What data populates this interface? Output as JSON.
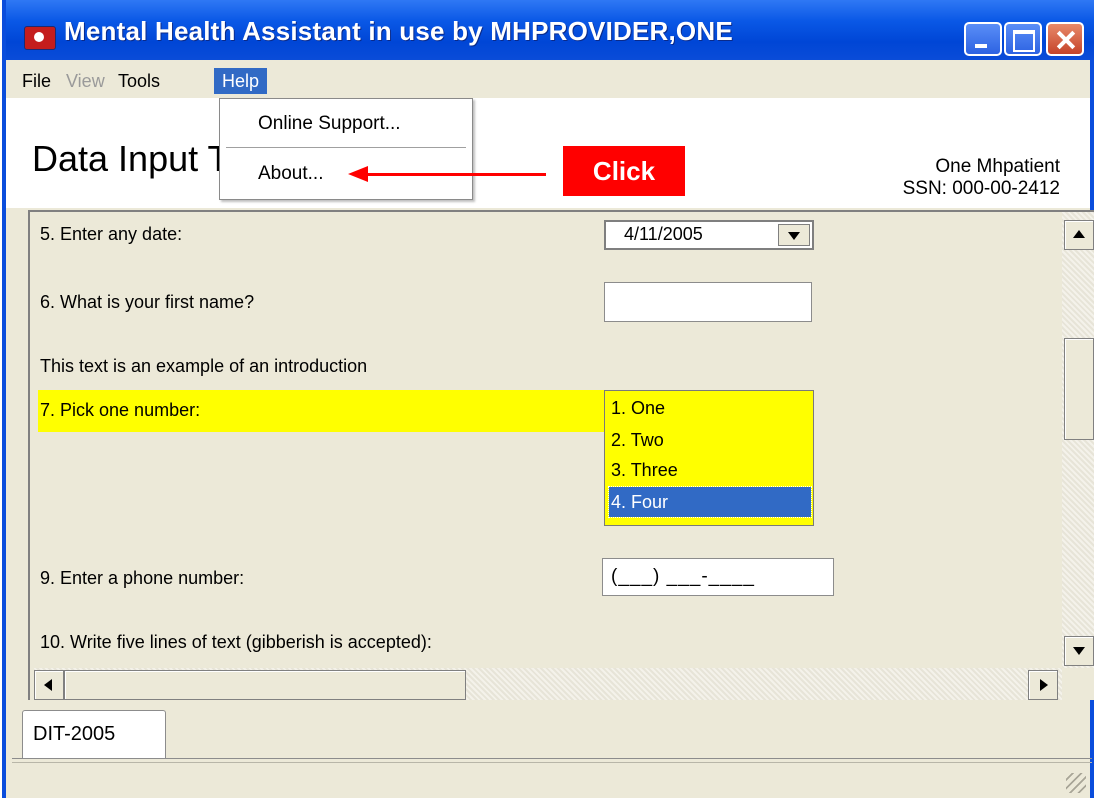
{
  "window": {
    "title": "Mental Health Assistant in use by MHPROVIDER,ONE",
    "accent_color": "#0a4ddc"
  },
  "menubar": {
    "items": [
      {
        "label": "File",
        "enabled": true
      },
      {
        "label": "View",
        "enabled": false
      },
      {
        "label": "Tools",
        "enabled": true
      },
      {
        "label": "Help",
        "enabled": true,
        "active": true
      }
    ]
  },
  "help_menu": {
    "items": [
      {
        "label": "Online Support..."
      },
      {
        "label": "About..."
      }
    ]
  },
  "annotation": {
    "label": "Click",
    "color": "#ff0000"
  },
  "header": {
    "title": "Data Input T",
    "patient_name": "One Mhpatient",
    "patient_ssn": "SSN: 000-00-2412"
  },
  "form": {
    "q5_label": "5. Enter any date:",
    "q5_value": "4/11/2005",
    "q6_label": "6. What is your first name?",
    "q6_value": "",
    "intro_text": "This text is an example of an introduction",
    "q7_label": "7. Pick one number:",
    "q7_options": [
      "1. One",
      "2. Two",
      "3. Three",
      "4. Four"
    ],
    "q7_selected": "4. Four",
    "q9_label": "9. Enter a phone number:",
    "q9_value": "(___) ___-____",
    "q10_label": "10. Write five lines of text (gibberish is accepted):",
    "highlight_color": "#ffff00"
  },
  "tabs": [
    {
      "label": "DIT-2005",
      "active": true
    }
  ]
}
